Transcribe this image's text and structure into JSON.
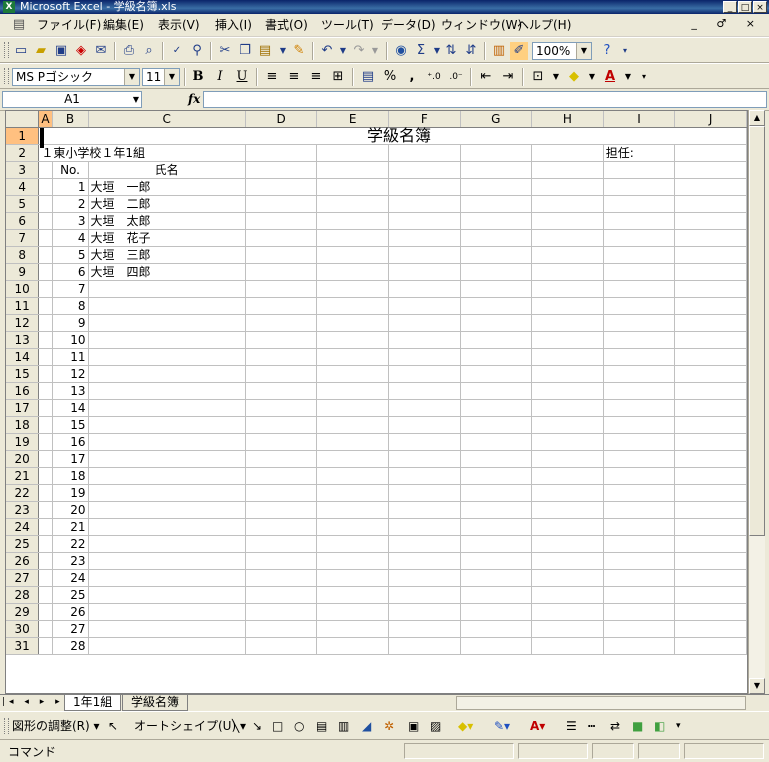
{
  "window": {
    "title": "Microsoft Excel - 学級名簿.xls",
    "controls": [
      "_",
      "□",
      "×"
    ]
  },
  "menu": {
    "items": [
      "ファイル(F)",
      "編集(E)",
      "表示(V)",
      "挿入(I)",
      "書式(O)",
      "ツール(T)",
      "データ(D)",
      "ウィンドウ(W)",
      "ヘルプ(H)"
    ],
    "doc_controls": "_ ♂ ×"
  },
  "toolbar": {
    "zoom": "100%",
    "font_name": "MS Pゴシック",
    "font_size": "11"
  },
  "formula_bar": {
    "name_box": "A1",
    "fx": "fx",
    "value": ""
  },
  "sheet": {
    "columns": [
      "A",
      "B",
      "C",
      "D",
      "E",
      "F",
      "G",
      "H",
      "I",
      "J"
    ],
    "title": "学級名簿",
    "class_label": "１東小学校１年1組",
    "teacher_label": "担任:",
    "no_header": "No.",
    "name_header": "氏名",
    "rows": [
      {
        "row": "1"
      },
      {
        "row": "2"
      },
      {
        "row": "3"
      },
      {
        "row": "4",
        "no": "1",
        "name": "大垣　一郎"
      },
      {
        "row": "5",
        "no": "2",
        "name": "大垣　二郎"
      },
      {
        "row": "6",
        "no": "3",
        "name": "大垣　太郎"
      },
      {
        "row": "7",
        "no": "4",
        "name": "大垣　花子"
      },
      {
        "row": "8",
        "no": "5",
        "name": "大垣　三郎"
      },
      {
        "row": "9",
        "no": "6",
        "name": "大垣　四郎"
      },
      {
        "row": "10",
        "no": "7"
      },
      {
        "row": "11",
        "no": "8"
      },
      {
        "row": "12",
        "no": "9"
      },
      {
        "row": "13",
        "no": "10"
      },
      {
        "row": "14",
        "no": "11"
      },
      {
        "row": "15",
        "no": "12"
      },
      {
        "row": "16",
        "no": "13"
      },
      {
        "row": "17",
        "no": "14"
      },
      {
        "row": "18",
        "no": "15"
      },
      {
        "row": "19",
        "no": "16"
      },
      {
        "row": "20",
        "no": "17"
      },
      {
        "row": "21",
        "no": "18"
      },
      {
        "row": "22",
        "no": "19"
      },
      {
        "row": "23",
        "no": "20"
      },
      {
        "row": "24",
        "no": "21"
      },
      {
        "row": "25",
        "no": "22"
      },
      {
        "row": "26",
        "no": "23"
      },
      {
        "row": "27",
        "no": "24"
      },
      {
        "row": "28",
        "no": "25"
      },
      {
        "row": "29",
        "no": "26"
      },
      {
        "row": "30",
        "no": "27"
      },
      {
        "row": "31",
        "no": "28"
      }
    ]
  },
  "tabs": {
    "nav": "|◂ ◂ ▸ ▸|",
    "items": [
      "1年1組",
      "学級名簿"
    ]
  },
  "drawing": {
    "adjust": "図形の調整(R) ▾",
    "autoshape": "オートシェイプ(U) ▾"
  },
  "status": {
    "text": "コマンド"
  }
}
